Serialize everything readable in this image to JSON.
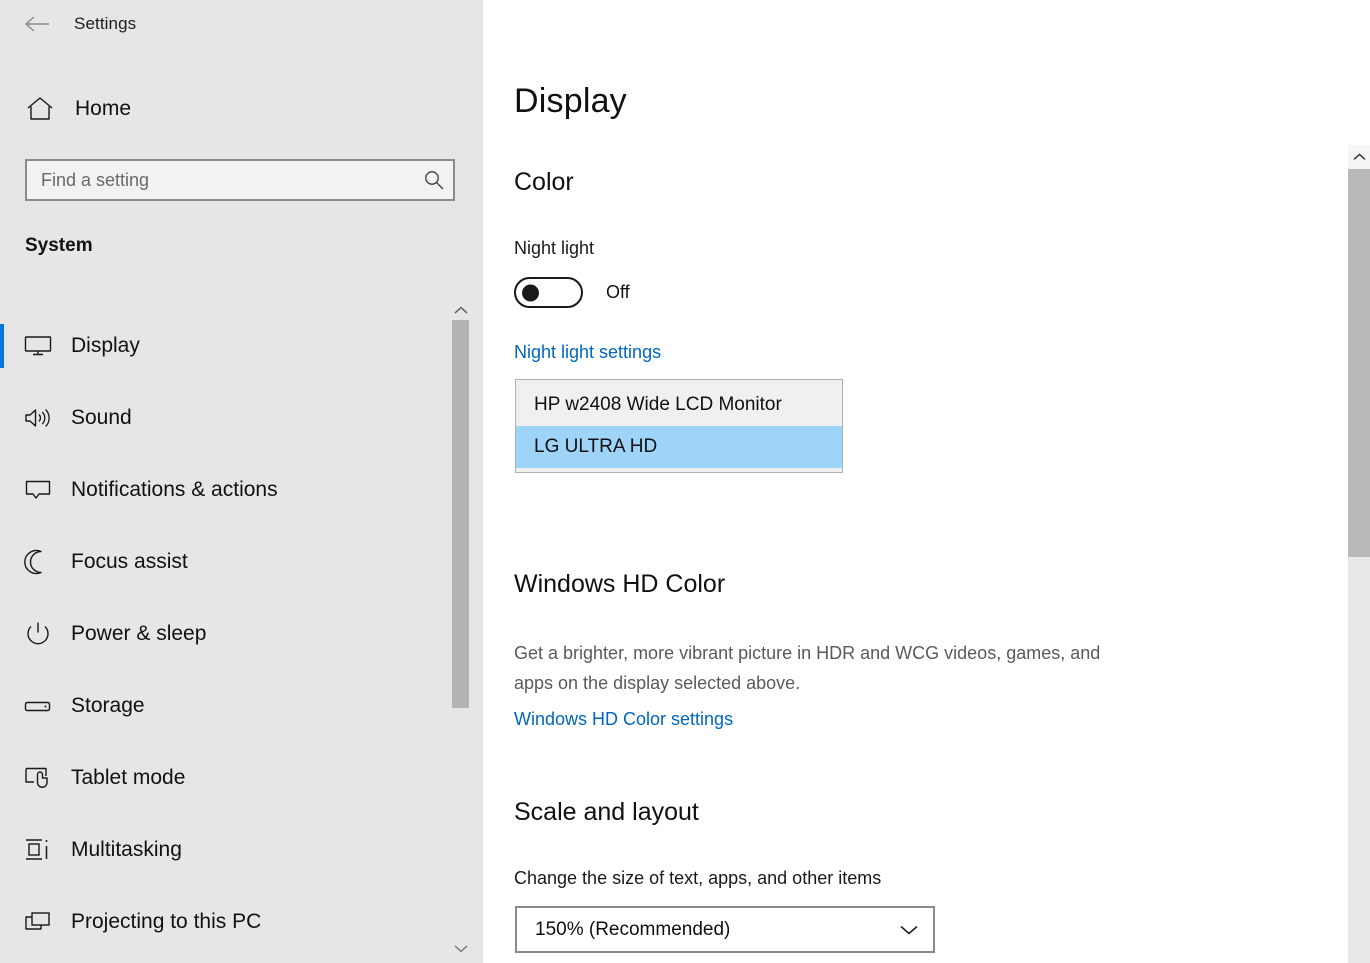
{
  "window": {
    "title": "Settings",
    "back_icon": "back-arrow-icon",
    "minimize_label": "—",
    "maximize_label": "□",
    "close_label": "✕"
  },
  "sidebar": {
    "home_label": "Home",
    "home_icon": "home-icon",
    "search": {
      "placeholder": "Find a setting",
      "value": "",
      "icon": "search-icon"
    },
    "group_title": "System",
    "items": [
      {
        "label": "Display",
        "icon": "monitor-icon",
        "selected": true
      },
      {
        "label": "Sound",
        "icon": "speaker-icon",
        "selected": false
      },
      {
        "label": "Notifications & actions",
        "icon": "notification-bubble-icon",
        "selected": false
      },
      {
        "label": "Focus assist",
        "icon": "moon-icon",
        "selected": false
      },
      {
        "label": "Power & sleep",
        "icon": "power-icon",
        "selected": false
      },
      {
        "label": "Storage",
        "icon": "drive-icon",
        "selected": false
      },
      {
        "label": "Tablet mode",
        "icon": "tablet-touch-icon",
        "selected": false
      },
      {
        "label": "Multitasking",
        "icon": "multitasking-icon",
        "selected": false
      },
      {
        "label": "Projecting to this PC",
        "icon": "projecting-icon",
        "selected": false
      }
    ],
    "scrollbar": {
      "up_icon": "chevron-up-icon",
      "down_icon": "chevron-down-icon"
    }
  },
  "main": {
    "page_title": "Display",
    "color_section": {
      "heading": "Color",
      "night_light_label": "Night light",
      "night_light_state": "Off",
      "night_light_on": false,
      "night_light_settings_link": "Night light settings"
    },
    "display_dropdown": {
      "open": true,
      "options": [
        {
          "label": "HP w2408 Wide LCD Monitor",
          "highlighted": false
        },
        {
          "label": "LG ULTRA HD",
          "highlighted": true
        }
      ]
    },
    "hd_color_section": {
      "heading": "Windows HD Color",
      "description": "Get a brighter, more vibrant picture in HDR and WCG videos, games, and apps on the display selected above.",
      "settings_link": "Windows HD Color settings"
    },
    "scale_section": {
      "heading": "Scale and layout",
      "label": "Change the size of text, apps, and other items",
      "selected_value": "150% (Recommended)",
      "chevron_icon": "chevron-down-icon"
    },
    "scrollbar": {
      "up_icon": "chevron-up-icon"
    }
  },
  "colors": {
    "accent": "#0078d7",
    "link": "#0067c0",
    "sidebar_bg": "#e6e6e6",
    "highlight": "#9fd4f9",
    "scrollbar_thumb": "#b4b4b4"
  }
}
